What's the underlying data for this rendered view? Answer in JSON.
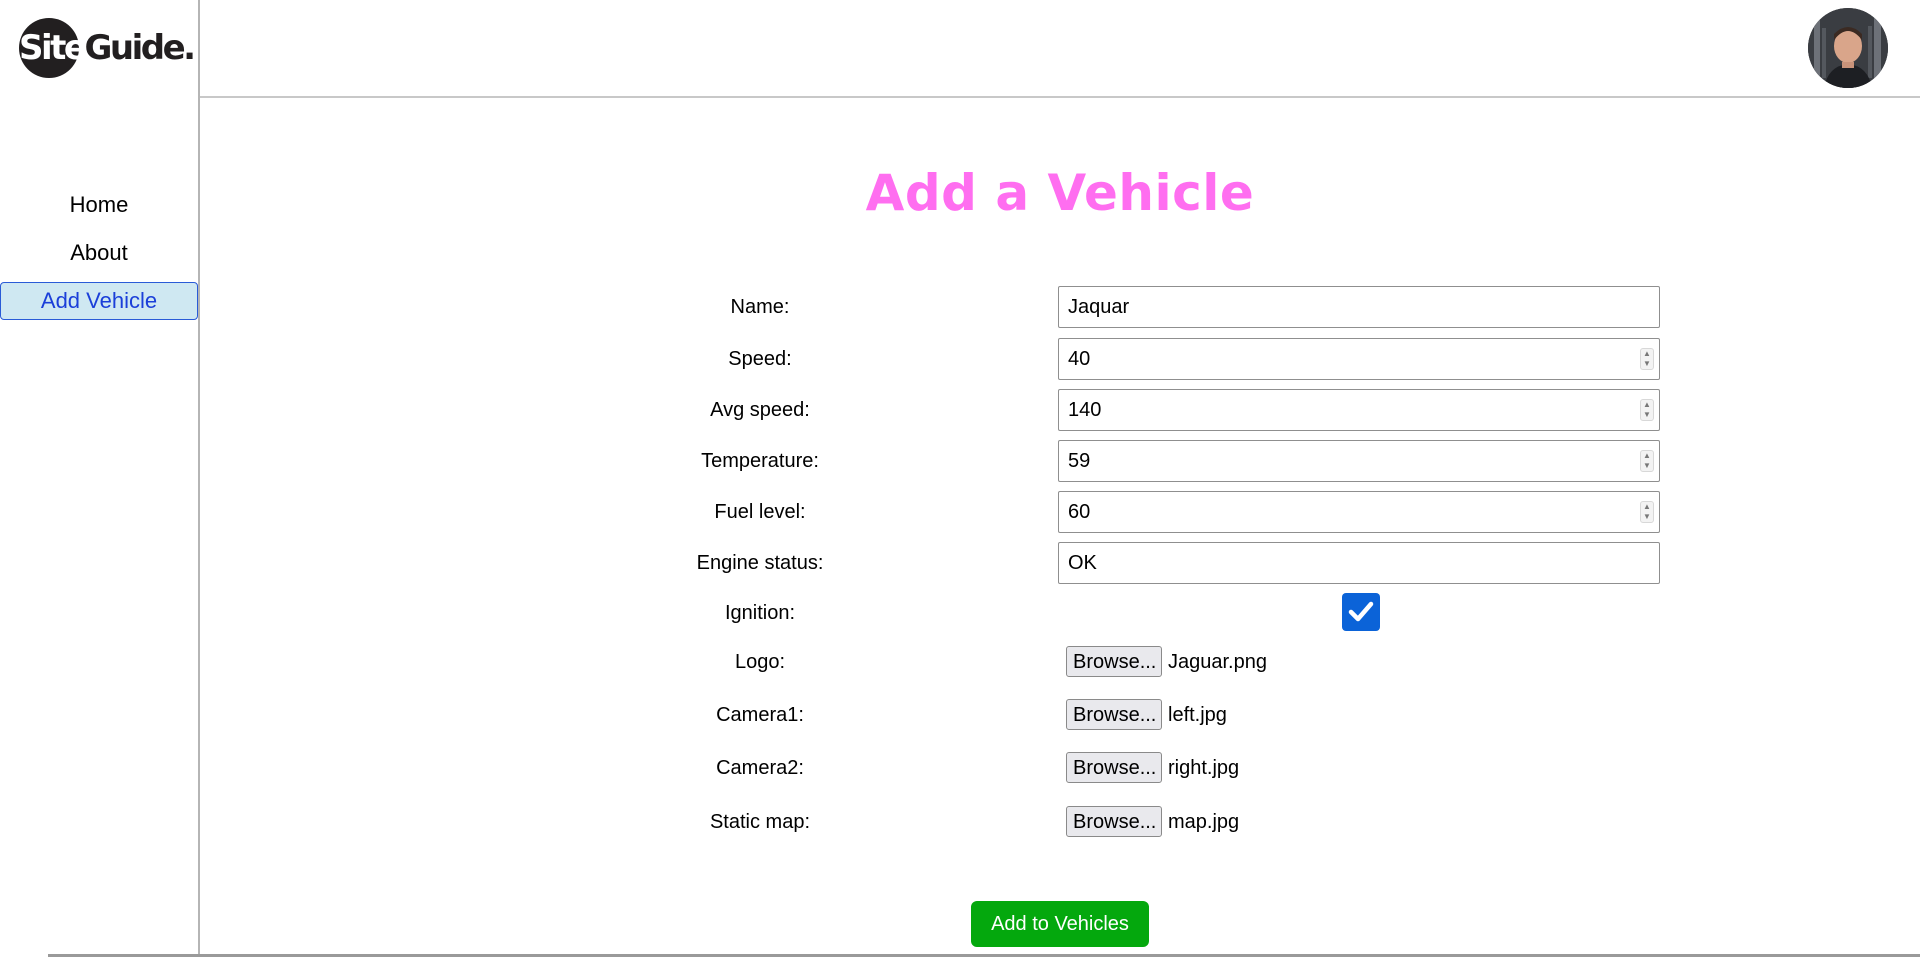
{
  "brand": {
    "logo_text_inverse": "Site",
    "logo_text": "Guide."
  },
  "sidebar": {
    "items": [
      {
        "label": "Home",
        "active": false
      },
      {
        "label": "About",
        "active": false
      },
      {
        "label": "Add Vehicle",
        "active": true
      }
    ]
  },
  "header": {
    "avatar_icon": "user-avatar"
  },
  "page": {
    "title": "Add a Vehicle"
  },
  "form": {
    "name": {
      "label": "Name:",
      "value": "Jaquar"
    },
    "speed": {
      "label": "Speed:",
      "value": "40"
    },
    "avg_speed": {
      "label": "Avg speed:",
      "value": "140"
    },
    "temperature": {
      "label": "Temperature:",
      "value": "59"
    },
    "fuel_level": {
      "label": "Fuel level:",
      "value": "60"
    },
    "engine_status": {
      "label": "Engine status:",
      "value": "OK"
    },
    "ignition": {
      "label": "Ignition:",
      "checked": true
    },
    "logo": {
      "label": "Logo:",
      "button": "Browse...",
      "file": "Jaguar.png"
    },
    "camera1": {
      "label": "Camera1:",
      "button": "Browse...",
      "file": "left.jpg"
    },
    "camera2": {
      "label": "Camera2:",
      "button": "Browse...",
      "file": "right.jpg"
    },
    "static_map": {
      "label": "Static map:",
      "button": "Browse...",
      "file": "map.jpg"
    },
    "submit_label": "Add to Vehicles"
  },
  "colors": {
    "title": "#ff6ef0",
    "active_nav_bg": "#cfe8f2",
    "active_nav_text": "#1b3fd9",
    "submit_bg": "#04a80d",
    "checkbox": "#0b63d8"
  }
}
